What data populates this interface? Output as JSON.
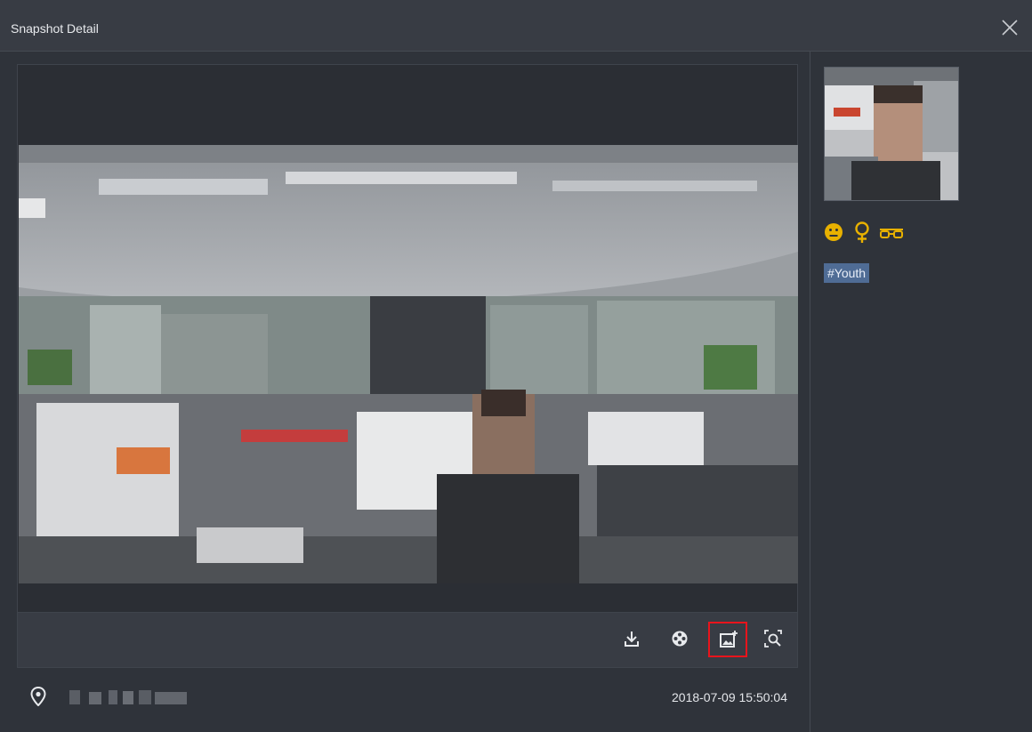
{
  "window": {
    "title": "Snapshot Detail",
    "close_icon": "close-icon"
  },
  "toolbar": {
    "buttons": [
      {
        "name": "download-button",
        "icon": "download-icon"
      },
      {
        "name": "video-playback-button",
        "icon": "film-reel-icon"
      },
      {
        "name": "add-to-library-button",
        "icon": "image-add-icon",
        "highlighted": true
      },
      {
        "name": "search-by-image-button",
        "icon": "search-frame-icon"
      }
    ]
  },
  "footer": {
    "location_icon": "location-pin-icon",
    "timestamp": "2018-07-09 15:50:04"
  },
  "attributes": {
    "icons": [
      "neutral-face-icon",
      "female-icon",
      "glasses-icon"
    ],
    "tag": "#Youth"
  },
  "colors": {
    "accent": "#e8b100",
    "tag_bg": "#4f6c95",
    "highlight_border": "#e8141c"
  }
}
